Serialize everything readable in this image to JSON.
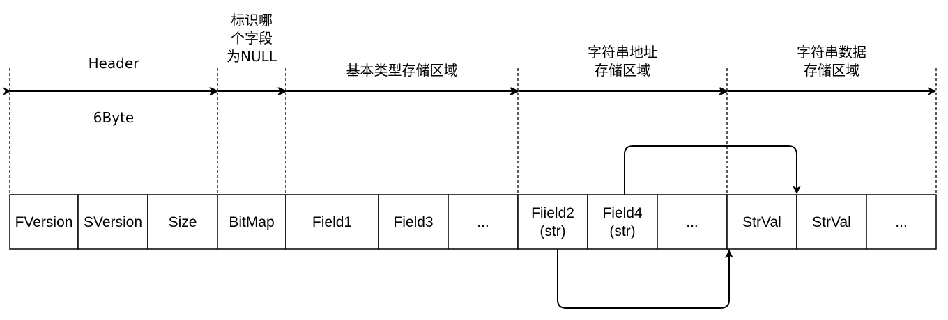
{
  "colors": {
    "stroke": "#000000",
    "cell_fill": "#ffffff",
    "background": "#ffffff"
  },
  "regions": [
    {
      "label_lines": [
        "Header"
      ],
      "below_label": "6Byte"
    },
    {
      "label_lines": [
        "标识哪",
        "个字段",
        "为NULL"
      ]
    },
    {
      "label_lines": [
        "基本类型存储区域"
      ]
    },
    {
      "label_lines": [
        "字符串地址",
        "存储区域"
      ]
    },
    {
      "label_lines": [
        "字符串数据",
        "存储区域"
      ]
    }
  ],
  "cells": [
    {
      "lines": [
        "FVersion"
      ]
    },
    {
      "lines": [
        "SVersion"
      ]
    },
    {
      "lines": [
        "Size"
      ]
    },
    {
      "lines": [
        "BitMap"
      ]
    },
    {
      "lines": [
        "Field1"
      ]
    },
    {
      "lines": [
        "Field3"
      ]
    },
    {
      "lines": [
        "..."
      ]
    },
    {
      "lines": [
        "Fiield2",
        "(str)"
      ]
    },
    {
      "lines": [
        "Field4",
        "(str)"
      ]
    },
    {
      "lines": [
        "..."
      ]
    },
    {
      "lines": [
        "StrVal"
      ]
    },
    {
      "lines": [
        "StrVal"
      ]
    },
    {
      "lines": [
        "..."
      ]
    }
  ],
  "pointers": [
    {
      "from_cell": 8,
      "to_cell": 11,
      "route": "over"
    },
    {
      "from_cell": 7,
      "to_cell": 10,
      "route": "under"
    }
  ]
}
